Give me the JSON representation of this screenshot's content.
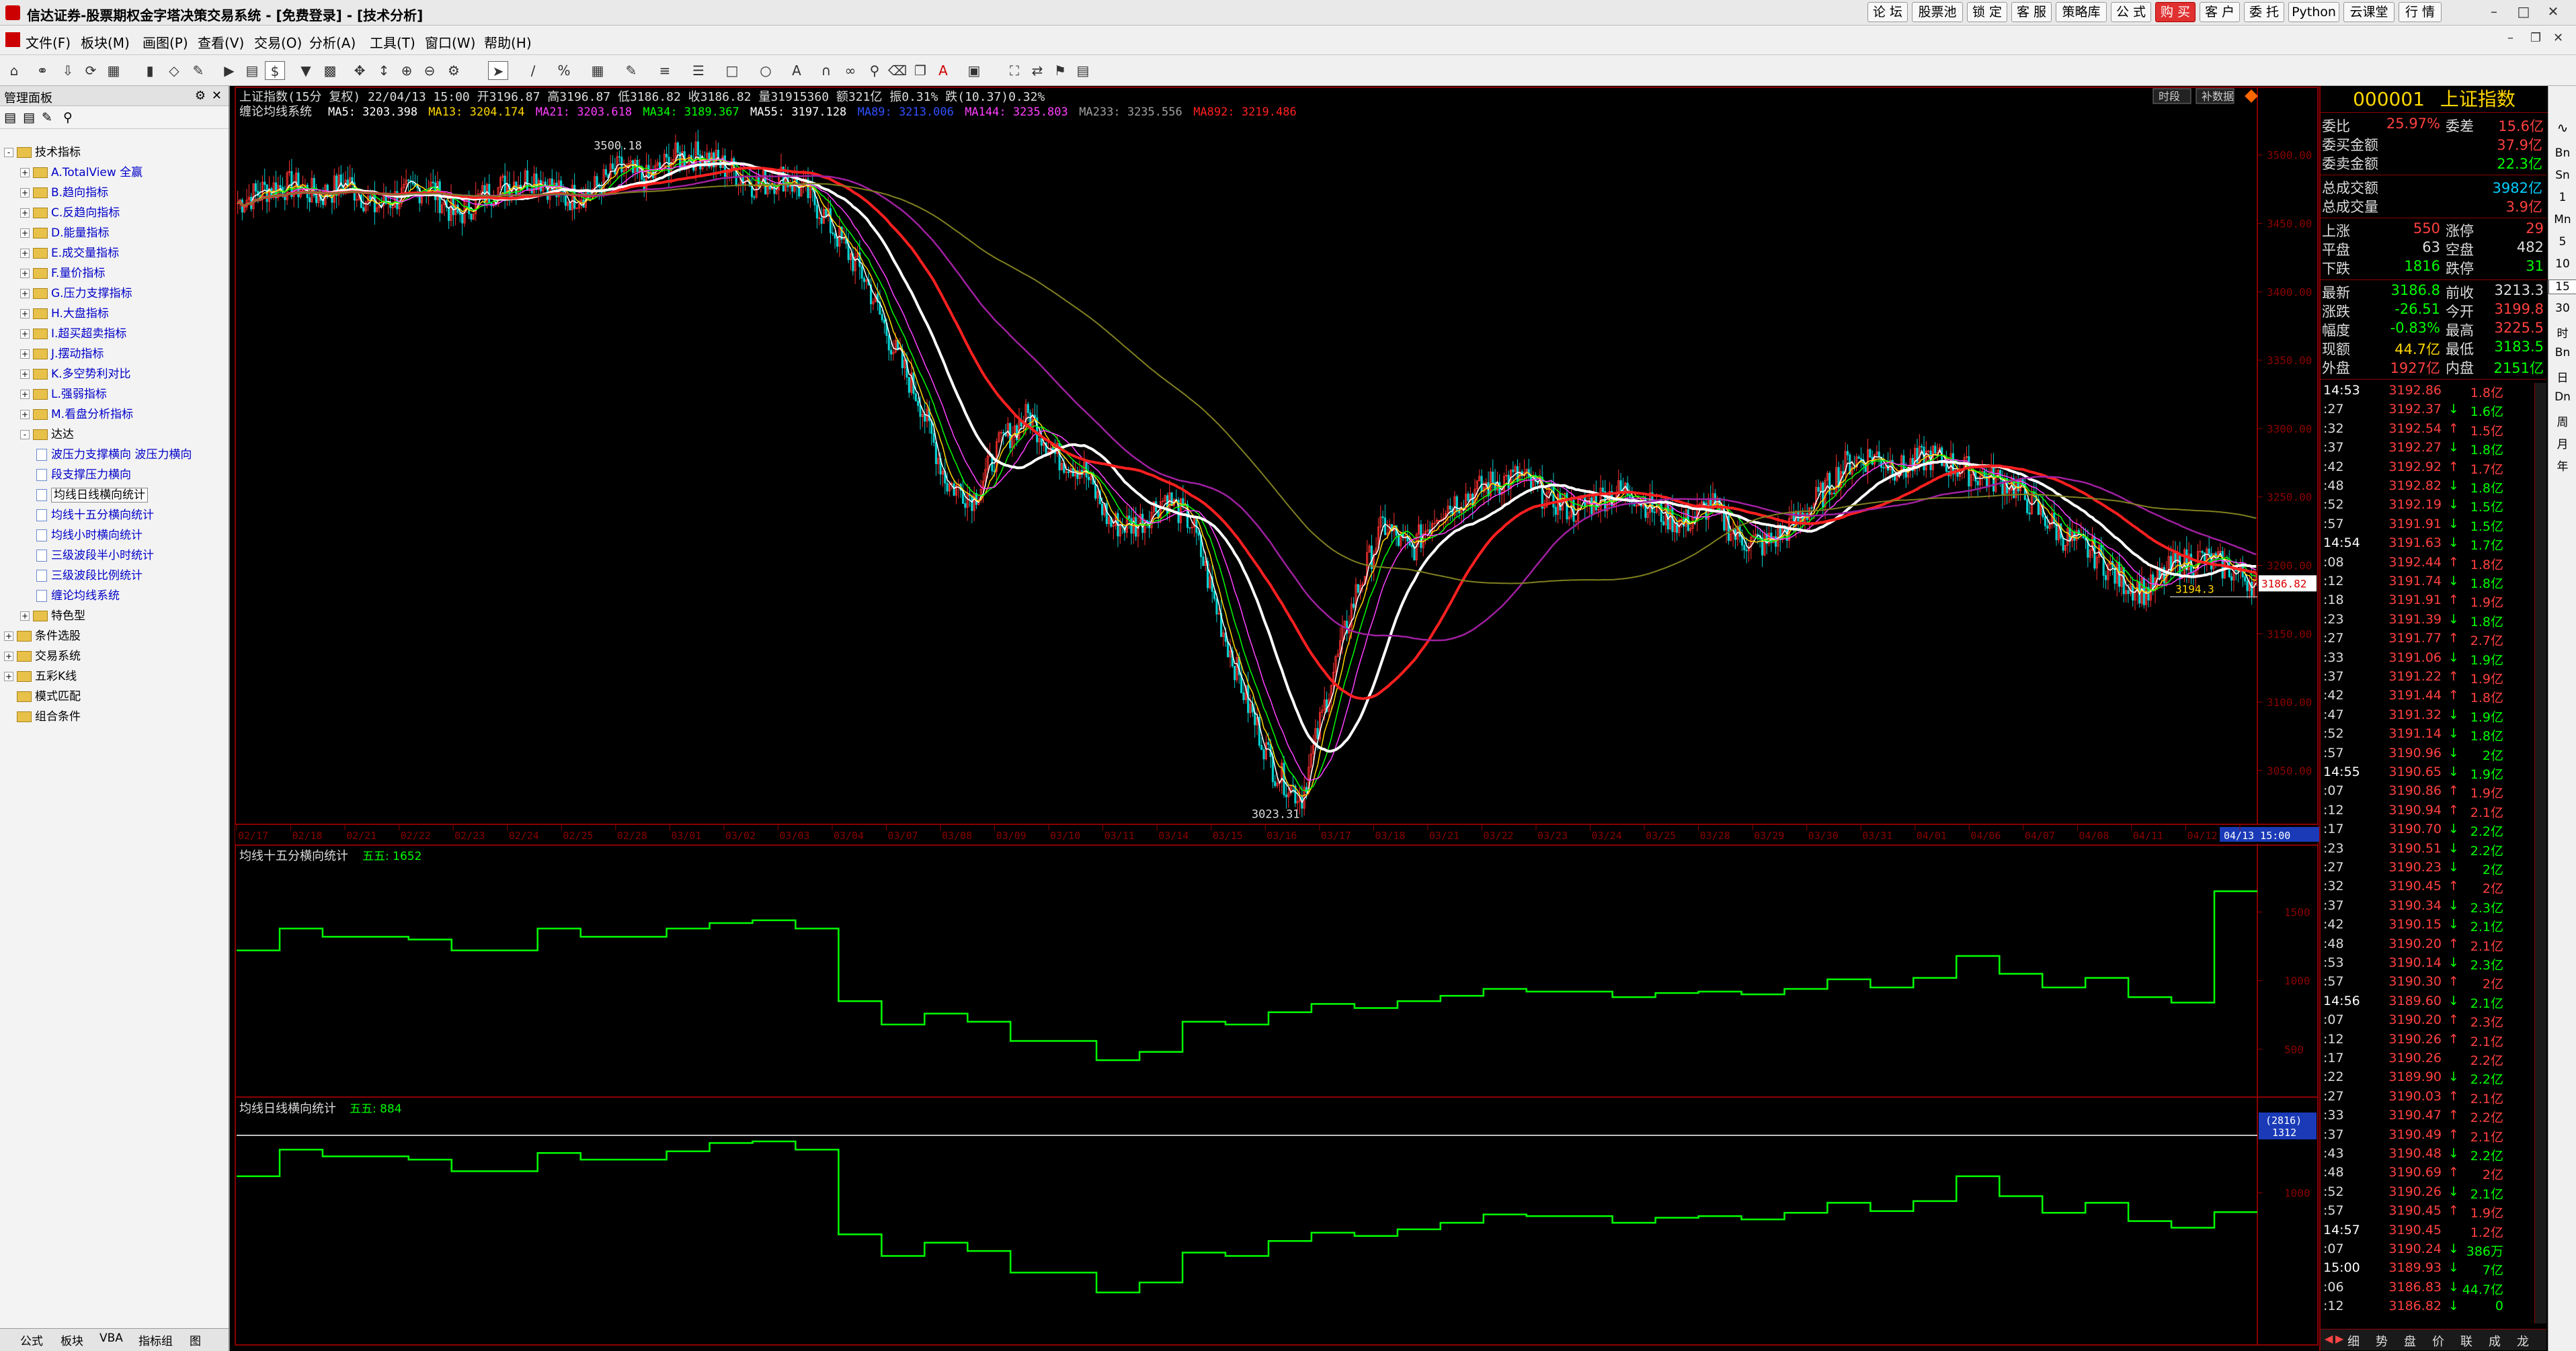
{
  "titlebar": {
    "title": "信达证券-股票期权金字塔决策交易系统 - [免费登录] - [技术分析]",
    "buttons": [
      "论 坛",
      "股票池",
      "锁 定",
      "客 服",
      "策略库",
      "公 式",
      "购 买",
      "客 户",
      "委 托",
      "Python",
      "云课堂",
      "行 情"
    ],
    "highlight_button": "购 买"
  },
  "menu": [
    "文件(F)",
    "板块(M)",
    "画图(P)",
    "查看(V)",
    "交易(O)",
    "分析(A)",
    "工具(T)",
    "窗口(W)",
    "帮助(H)"
  ],
  "left_panel": {
    "title": "管理面板",
    "tree": [
      {
        "label": "技术指标",
        "level": 0,
        "type": "folder",
        "exp": "-"
      },
      {
        "label": "A.TotalView 全赢",
        "level": 1,
        "type": "folder",
        "exp": "+",
        "blue": true
      },
      {
        "label": "B.趋向指标",
        "level": 1,
        "type": "folder",
        "exp": "+",
        "blue": true
      },
      {
        "label": "C.反趋向指标",
        "level": 1,
        "type": "folder",
        "exp": "+",
        "blue": true
      },
      {
        "label": "D.能量指标",
        "level": 1,
        "type": "folder",
        "exp": "+",
        "blue": true
      },
      {
        "label": "E.成交量指标",
        "level": 1,
        "type": "folder",
        "exp": "+",
        "blue": true
      },
      {
        "label": "F.量价指标",
        "level": 1,
        "type": "folder",
        "exp": "+",
        "blue": true
      },
      {
        "label": "G.压力支撑指标",
        "level": 1,
        "type": "folder",
        "exp": "+",
        "blue": true
      },
      {
        "label": "H.大盘指标",
        "level": 1,
        "type": "folder",
        "exp": "+",
        "blue": true
      },
      {
        "label": "I.超买超卖指标",
        "level": 1,
        "type": "folder",
        "exp": "+",
        "blue": true
      },
      {
        "label": "J.摆动指标",
        "level": 1,
        "type": "folder",
        "exp": "+",
        "blue": true
      },
      {
        "label": "K.多空势利对比",
        "level": 1,
        "type": "folder",
        "exp": "+",
        "blue": true
      },
      {
        "label": "L.强弱指标",
        "level": 1,
        "type": "folder",
        "exp": "+",
        "blue": true
      },
      {
        "label": "M.看盘分析指标",
        "level": 1,
        "type": "folder",
        "exp": "+",
        "blue": true
      },
      {
        "label": "达达",
        "level": 1,
        "type": "folder",
        "exp": "-"
      },
      {
        "label": "波压力支撑横向 波压力横向",
        "level": 2,
        "type": "doc",
        "blue": true
      },
      {
        "label": "段支撑压力横向",
        "level": 2,
        "type": "doc",
        "blue": true
      },
      {
        "label": "均线日线横向统计",
        "level": 2,
        "type": "doc",
        "sel": true
      },
      {
        "label": "均线十五分横向统计",
        "level": 2,
        "type": "doc",
        "blue": true
      },
      {
        "label": "均线小时横向统计",
        "level": 2,
        "type": "doc",
        "blue": true
      },
      {
        "label": "三级波段半小时统计",
        "level": 2,
        "type": "doc",
        "blue": true
      },
      {
        "label": "三级波段比例统计",
        "level": 2,
        "type": "doc",
        "blue": true
      },
      {
        "label": "缠论均线系统",
        "level": 2,
        "type": "doc",
        "blue": true
      },
      {
        "label": "特色型",
        "level": 1,
        "type": "folder",
        "exp": "+"
      },
      {
        "label": "条件选股",
        "level": 0,
        "type": "folder",
        "exp": "+"
      },
      {
        "label": "交易系统",
        "level": 0,
        "type": "folder",
        "exp": "+"
      },
      {
        "label": "五彩K线",
        "level": 0,
        "type": "folder",
        "exp": "+"
      },
      {
        "label": "模式匹配",
        "level": 0,
        "type": "folder",
        "exp": ""
      },
      {
        "label": "组合条件",
        "level": 0,
        "type": "folder",
        "exp": ""
      }
    ],
    "tabs": [
      "公式",
      "板块",
      "VBA",
      "指标组",
      "图"
    ]
  },
  "chart_header": {
    "line1": "上证指数(15分 复权) 22/04/13 15:00 开3196.87 高3196.87 低3186.82 收3186.82 量31915360 额321亿 振0.31% 跌(10.37)0.32%",
    "line2_label": "缠论均线系统",
    "ma_labels": [
      {
        "text": "MA5: 3203.398",
        "color": "#ffffff"
      },
      {
        "text": "MA13: 3204.174",
        "color": "#ffd700"
      },
      {
        "text": "MA21: 3203.618",
        "color": "#ff40ff"
      },
      {
        "text": "MA34: 3189.367",
        "color": "#00ff00"
      },
      {
        "text": "MA55: 3197.128",
        "color": "#ffffff"
      },
      {
        "text": "MA89: 3213.006",
        "color": "#3050ff"
      },
      {
        "text": "MA144: 3235.803",
        "color": "#ff40ff"
      },
      {
        "text": "MA233: 3235.556",
        "color": "#a0a0a0"
      },
      {
        "text": "MA892: 3219.486",
        "color": "#ff2020"
      }
    ],
    "top_right_buttons": [
      "时段",
      "补数据"
    ]
  },
  "chart_data": [
    {
      "type": "candlestick",
      "title": "上证指数(15分 复权)",
      "x_dates": [
        "02/17",
        "02/18",
        "02/21",
        "02/22",
        "02/23",
        "02/24",
        "02/25",
        "02/28",
        "03/01",
        "03/02",
        "03/03",
        "03/04",
        "03/07",
        "03/08",
        "03/09",
        "03/10",
        "03/11",
        "03/14",
        "03/15",
        "03/16",
        "03/17",
        "03/18",
        "03/21",
        "03/22",
        "03/23",
        "03/24",
        "03/25",
        "03/28",
        "03/29",
        "03/30",
        "03/31",
        "04/01",
        "04/06",
        "04/07",
        "04/08",
        "04/11",
        "04/12",
        "04/13 15:00"
      ],
      "y_ticks": [
        3050,
        3100,
        3150,
        3200,
        3250,
        3300,
        3350,
        3400,
        3450,
        3500
      ],
      "ylim": [
        3020,
        3520
      ],
      "close_path": [
        3465,
        3475,
        3478,
        3470,
        3480,
        3462,
        3470,
        3478,
        3455,
        3470,
        3480,
        3484,
        3468,
        3474,
        3490,
        3482,
        3498,
        3500,
        3490,
        3478,
        3484,
        3470,
        3440,
        3410,
        3360,
        3320,
        3260,
        3250,
        3290,
        3310,
        3280,
        3270,
        3230,
        3230,
        3250,
        3230,
        3160,
        3100,
        3050,
        3030,
        3110,
        3180,
        3230,
        3210,
        3240,
        3250,
        3260,
        3265,
        3250,
        3240,
        3250,
        3255,
        3240,
        3230,
        3245,
        3220,
        3215,
        3230,
        3250,
        3275,
        3280,
        3270,
        3280,
        3272,
        3265,
        3260,
        3240,
        3220,
        3210,
        3190,
        3180,
        3200,
        3205,
        3198,
        3186.82
      ],
      "annotations": [
        {
          "text": "3500.18",
          "price": 3500.18
        },
        {
          "text": "3023.31",
          "price": 3023.31
        }
      ],
      "last_price": "3186.82",
      "current_marker": "3194.3"
    },
    {
      "type": "step",
      "title": "均线十五分横向统计",
      "legend": "五五: 1652",
      "y_ticks": [
        500,
        1000,
        1500
      ],
      "ylim": [
        200,
        1900
      ],
      "values": [
        1220,
        1380,
        1320,
        1320,
        1300,
        1220,
        1220,
        1380,
        1320,
        1320,
        1380,
        1420,
        1440,
        1380,
        850,
        680,
        760,
        700,
        560,
        560,
        420,
        480,
        700,
        680,
        770,
        830,
        800,
        850,
        890,
        940,
        920,
        920,
        880,
        910,
        920,
        900,
        940,
        1010,
        950,
        1020,
        1180,
        1050,
        950,
        1020,
        880,
        840,
        1652
      ]
    },
    {
      "type": "step",
      "title": "均线日线横向统计",
      "legend": "五五: 884",
      "y_ticks": [
        1000
      ],
      "ylim": [
        100,
        1500
      ],
      "markers": [
        "(2816)",
        "1312"
      ],
      "values": [
        1100,
        1260,
        1220,
        1220,
        1200,
        1130,
        1130,
        1240,
        1200,
        1200,
        1250,
        1300,
        1310,
        1260,
        750,
        620,
        700,
        650,
        520,
        520,
        400,
        460,
        640,
        620,
        710,
        760,
        740,
        780,
        820,
        870,
        860,
        860,
        820,
        850,
        860,
        840,
        880,
        940,
        890,
        950,
        1100,
        980,
        880,
        940,
        830,
        790,
        884
      ]
    }
  ],
  "quote": {
    "code": "000001",
    "name": "上证指数",
    "rows": [
      {
        "k1": "委比",
        "v1": "25.97%",
        "k2": "委差",
        "v2": "15.6亿"
      },
      {
        "k1": "委买金额",
        "v1": "37.9亿"
      },
      {
        "k1": "委卖金额",
        "v1": "22.3亿"
      },
      {
        "k1": "总成交额",
        "v1": "3982亿"
      },
      {
        "k1": "总成交量",
        "v1": "3.9亿"
      },
      {
        "k1": "上涨",
        "v1": "550",
        "k2": "涨停",
        "v2": "29"
      },
      {
        "k1": "平盘",
        "v1": "63",
        "k2": "空盘",
        "v2": "482"
      },
      {
        "k1": "下跌",
        "v1": "1816",
        "k2": "跌停",
        "v2": "31"
      },
      {
        "k1": "最新",
        "v1": "3186.8",
        "k2": "前收",
        "v2": "3213.3"
      },
      {
        "k1": "涨跌",
        "v1": "-26.51",
        "k2": "今开",
        "v2": "3199.8"
      },
      {
        "k1": "幅度",
        "v1": "-0.83%",
        "k2": "最高",
        "v2": "3225.5"
      },
      {
        "k1": "现额",
        "v1": "44.7亿",
        "k2": "最低",
        "v2": "3183.5"
      },
      {
        "k1": "外盘",
        "v1": "1927亿",
        "k2": "内盘",
        "v2": "2151亿"
      }
    ],
    "ticks": [
      {
        "t": "14:53",
        "p": "3192.86",
        "a": "",
        "vol": "1.8亿"
      },
      {
        "t": ":27",
        "p": "3192.37",
        "a": "↓",
        "vol": "1.6亿"
      },
      {
        "t": ":32",
        "p": "3192.54",
        "a": "↑",
        "vol": "1.5亿"
      },
      {
        "t": ":37",
        "p": "3192.27",
        "a": "↓",
        "vol": "1.8亿"
      },
      {
        "t": ":42",
        "p": "3192.92",
        "a": "↑",
        "vol": "1.7亿"
      },
      {
        "t": ":48",
        "p": "3192.82",
        "a": "↓",
        "vol": "1.8亿"
      },
      {
        "t": ":52",
        "p": "3192.19",
        "a": "↓",
        "vol": "1.5亿"
      },
      {
        "t": ":57",
        "p": "3191.91",
        "a": "↓",
        "vol": "1.5亿"
      },
      {
        "t": "14:54",
        "p": "3191.63",
        "a": "↓",
        "vol": "1.7亿"
      },
      {
        "t": ":08",
        "p": "3192.44",
        "a": "↑",
        "vol": "1.8亿"
      },
      {
        "t": ":12",
        "p": "3191.74",
        "a": "↓",
        "vol": "1.8亿"
      },
      {
        "t": ":18",
        "p": "3191.91",
        "a": "↑",
        "vol": "1.9亿"
      },
      {
        "t": ":23",
        "p": "3191.39",
        "a": "↓",
        "vol": "1.8亿"
      },
      {
        "t": ":27",
        "p": "3191.77",
        "a": "↑",
        "vol": "2.7亿"
      },
      {
        "t": ":33",
        "p": "3191.06",
        "a": "↓",
        "vol": "1.9亿"
      },
      {
        "t": ":37",
        "p": "3191.22",
        "a": "↑",
        "vol": "1.9亿"
      },
      {
        "t": ":42",
        "p": "3191.44",
        "a": "↑",
        "vol": "1.8亿"
      },
      {
        "t": ":47",
        "p": "3191.32",
        "a": "↓",
        "vol": "1.9亿"
      },
      {
        "t": ":52",
        "p": "3191.14",
        "a": "↓",
        "vol": "1.8亿"
      },
      {
        "t": ":57",
        "p": "3190.96",
        "a": "↓",
        "vol": "2亿"
      },
      {
        "t": "14:55",
        "p": "3190.65",
        "a": "↓",
        "vol": "1.9亿"
      },
      {
        "t": ":07",
        "p": "3190.86",
        "a": "↑",
        "vol": "1.9亿"
      },
      {
        "t": ":12",
        "p": "3190.94",
        "a": "↑",
        "vol": "2.1亿"
      },
      {
        "t": ":17",
        "p": "3190.70",
        "a": "↓",
        "vol": "2.2亿"
      },
      {
        "t": ":23",
        "p": "3190.51",
        "a": "↓",
        "vol": "2.2亿"
      },
      {
        "t": ":27",
        "p": "3190.23",
        "a": "↓",
        "vol": "2亿"
      },
      {
        "t": ":32",
        "p": "3190.45",
        "a": "↑",
        "vol": "2亿"
      },
      {
        "t": ":37",
        "p": "3190.34",
        "a": "↓",
        "vol": "2.3亿"
      },
      {
        "t": ":42",
        "p": "3190.15",
        "a": "↓",
        "vol": "2.1亿"
      },
      {
        "t": ":48",
        "p": "3190.20",
        "a": "↑",
        "vol": "2.1亿"
      },
      {
        "t": ":53",
        "p": "3190.14",
        "a": "↓",
        "vol": "2.3亿"
      },
      {
        "t": ":57",
        "p": "3190.30",
        "a": "↑",
        "vol": "2亿"
      },
      {
        "t": "14:56",
        "p": "3189.60",
        "a": "↓",
        "vol": "2.1亿"
      },
      {
        "t": ":07",
        "p": "3190.20",
        "a": "↑",
        "vol": "2.3亿"
      },
      {
        "t": ":12",
        "p": "3190.26",
        "a": "↑",
        "vol": "2.1亿"
      },
      {
        "t": ":17",
        "p": "3190.26",
        "a": "",
        "vol": "2.2亿"
      },
      {
        "t": ":22",
        "p": "3189.90",
        "a": "↓",
        "vol": "2.2亿"
      },
      {
        "t": ":27",
        "p": "3190.03",
        "a": "↑",
        "vol": "2.1亿"
      },
      {
        "t": ":33",
        "p": "3190.47",
        "a": "↑",
        "vol": "2.2亿"
      },
      {
        "t": ":37",
        "p": "3190.49",
        "a": "↑",
        "vol": "2.1亿"
      },
      {
        "t": ":43",
        "p": "3190.48",
        "a": "↓",
        "vol": "2.2亿"
      },
      {
        "t": ":48",
        "p": "3190.69",
        "a": "↑",
        "vol": "2亿"
      },
      {
        "t": ":52",
        "p": "3190.26",
        "a": "↓",
        "vol": "2.1亿"
      },
      {
        "t": ":57",
        "p": "3190.45",
        "a": "↑",
        "vol": "1.9亿"
      },
      {
        "t": "14:57",
        "p": "3190.45",
        "a": "",
        "vol": "1.2亿"
      },
      {
        "t": ":07",
        "p": "3190.24",
        "a": "↓",
        "vol": "386万"
      },
      {
        "t": "15:00",
        "p": "3189.93",
        "a": "↓",
        "vol": "7亿"
      },
      {
        "t": ":06",
        "p": "3186.83",
        "a": "↓",
        "vol": "44.7亿"
      },
      {
        "t": ":12",
        "p": "3186.82",
        "a": "↓",
        "vol": "0"
      }
    ],
    "bottom_tabs": [
      "细",
      "势",
      "盘",
      "价",
      "联",
      "成",
      "龙"
    ]
  },
  "side_strip": [
    "Bn",
    "Sn",
    "1",
    "Mn",
    "5",
    "10",
    "15",
    "30",
    "时",
    "Bn",
    "日",
    "Dn",
    "周",
    "月",
    "年"
  ]
}
